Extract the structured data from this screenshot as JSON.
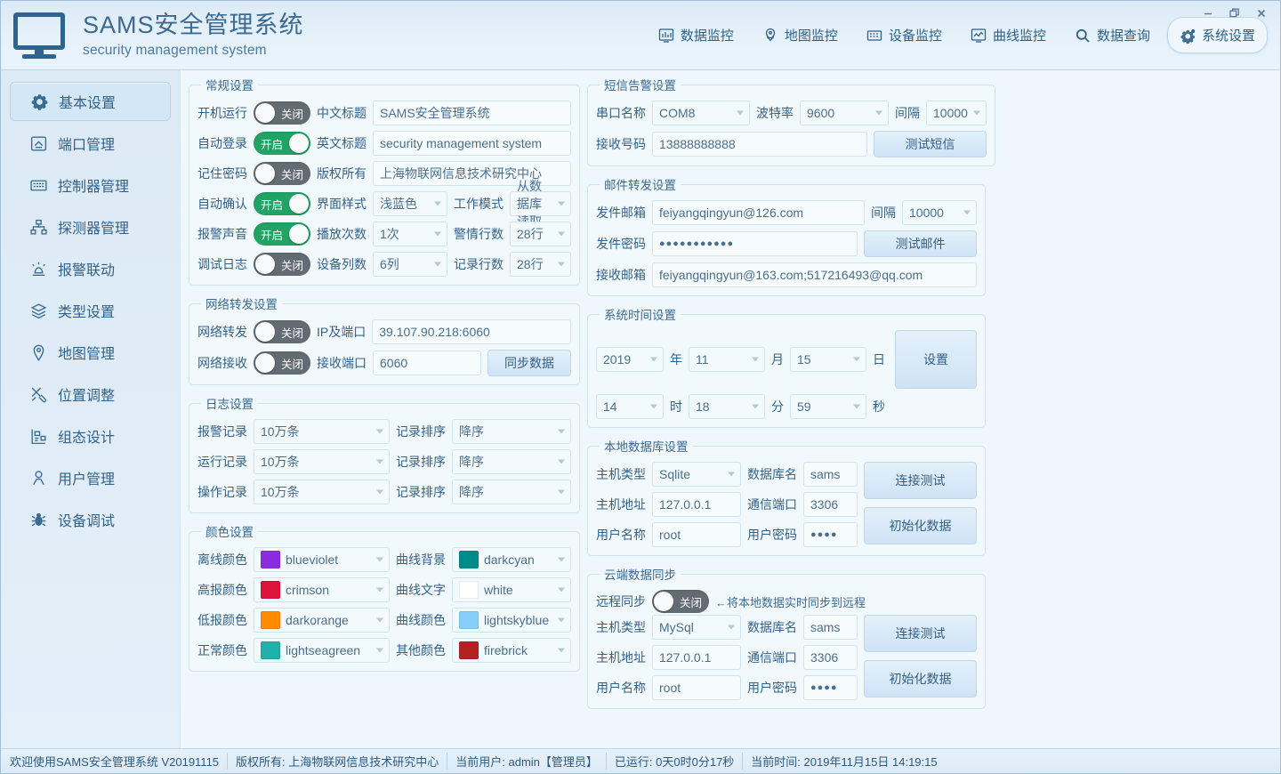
{
  "window": {
    "title_cn": "SAMS安全管理系统",
    "title_en": "security management system",
    "minimize": "─",
    "maximize": "❐",
    "close": "✕"
  },
  "nav": [
    {
      "label": "数据监控",
      "icon": "data-monitor-icon",
      "active": false
    },
    {
      "label": "地图监控",
      "icon": "map-monitor-icon",
      "active": false
    },
    {
      "label": "设备监控",
      "icon": "device-monitor-icon",
      "active": false
    },
    {
      "label": "曲线监控",
      "icon": "curve-monitor-icon",
      "active": false
    },
    {
      "label": "数据查询",
      "icon": "search-icon",
      "active": false
    },
    {
      "label": "系统设置",
      "icon": "gear-icon",
      "active": true
    }
  ],
  "sidebar": [
    {
      "label": "基本设置",
      "icon": "gear-icon",
      "active": true
    },
    {
      "label": "端口管理",
      "icon": "port-icon",
      "active": false
    },
    {
      "label": "控制器管理",
      "icon": "controller-icon",
      "active": false
    },
    {
      "label": "探测器管理",
      "icon": "detector-icon",
      "active": false
    },
    {
      "label": "报警联动",
      "icon": "alarm-icon",
      "active": false
    },
    {
      "label": "类型设置",
      "icon": "layers-icon",
      "active": false
    },
    {
      "label": "地图管理",
      "icon": "map-pin-icon",
      "active": false
    },
    {
      "label": "位置调整",
      "icon": "tools-icon",
      "active": false
    },
    {
      "label": "组态设计",
      "icon": "design-icon",
      "active": false
    },
    {
      "label": "用户管理",
      "icon": "user-icon",
      "active": false
    },
    {
      "label": "设备调试",
      "icon": "bug-icon",
      "active": false
    }
  ],
  "general": {
    "legend": "常规设置",
    "rows": [
      {
        "label": "开机运行",
        "switch": {
          "state": "off",
          "text": "关闭"
        },
        "label2": "中文标题",
        "value": "SAMS安全管理系统"
      },
      {
        "label": "自动登录",
        "switch": {
          "state": "on",
          "text": "开启"
        },
        "label2": "英文标题",
        "value": "security management system"
      },
      {
        "label": "记住密码",
        "switch": {
          "state": "off",
          "text": "关闭"
        },
        "label2": "版权所有",
        "value": "上海物联网信息技术研究中心"
      }
    ],
    "row4": {
      "label": "自动确认",
      "switch": {
        "state": "on",
        "text": "开启"
      },
      "label2": "界面样式",
      "value2": "浅蓝色",
      "label3": "工作模式",
      "value3": "从数据库读取"
    },
    "row5": {
      "label": "报警声音",
      "switch": {
        "state": "on",
        "text": "开启"
      },
      "label2": "播放次数",
      "value2": "1次",
      "label3": "警情行数",
      "value3": "28行"
    },
    "row6": {
      "label": "调试日志",
      "switch": {
        "state": "off",
        "text": "关闭"
      },
      "label2": "设备列数",
      "value2": "6列",
      "label3": "记录行数",
      "value3": "28行"
    }
  },
  "network": {
    "legend": "网络转发设置",
    "forward_label": "网络转发",
    "forward_switch": {
      "state": "off",
      "text": "关闭"
    },
    "ip_label": "IP及端口",
    "ip_value": "39.107.90.218:6060",
    "receive_label": "网络接收",
    "receive_switch": {
      "state": "off",
      "text": "关闭"
    },
    "port_label": "接收端口",
    "port_value": "6060",
    "sync_button": "同步数据"
  },
  "log": {
    "legend": "日志设置",
    "rows": [
      {
        "label": "报警记录",
        "value": "10万条",
        "label2": "记录排序",
        "value2": "降序"
      },
      {
        "label": "运行记录",
        "value": "10万条",
        "label2": "记录排序",
        "value2": "降序"
      },
      {
        "label": "操作记录",
        "value": "10万条",
        "label2": "记录排序",
        "value2": "降序"
      }
    ]
  },
  "colors": {
    "legend": "颜色设置",
    "rows": [
      {
        "label": "离线颜色",
        "value": "blueviolet",
        "hex": "#8a2be2",
        "label2": "曲线背景",
        "value2": "darkcyan",
        "hex2": "#008b8b"
      },
      {
        "label": "高报颜色",
        "value": "crimson",
        "hex": "#dc143c",
        "label2": "曲线文字",
        "value2": "white",
        "hex2": "#ffffff"
      },
      {
        "label": "低报颜色",
        "value": "darkorange",
        "hex": "#ff8c00",
        "label2": "曲线颜色",
        "value2": "lightskyblue",
        "hex2": "#87cefa"
      },
      {
        "label": "正常颜色",
        "value": "lightseagreen",
        "hex": "#20b2aa",
        "label2": "其他颜色",
        "value2": "firebrick",
        "hex2": "#b22222"
      }
    ]
  },
  "sms": {
    "legend": "短信告警设置",
    "port_label": "串口名称",
    "port_value": "COM8",
    "baud_label": "波特率",
    "baud_value": "9600",
    "interval_label": "间隔",
    "interval_value": "10000",
    "number_label": "接收号码",
    "number_value": "13888888888",
    "test_button": "测试短信"
  },
  "email": {
    "legend": "邮件转发设置",
    "sender_label": "发件邮箱",
    "sender_value": "feiyangqingyun@126.com",
    "interval_label": "间隔",
    "interval_value": "10000",
    "password_label": "发件密码",
    "password_value": "●●●●●●●●●●●",
    "test_button": "测试邮件",
    "receiver_label": "接收邮箱",
    "receiver_value": "feiyangqingyun@163.com;517216493@qq.com"
  },
  "systime": {
    "legend": "系统时间设置",
    "year": "2019",
    "year_unit": "年",
    "month": "11",
    "month_unit": "月",
    "day": "15",
    "day_unit": "日",
    "hour": "14",
    "hour_unit": "时",
    "minute": "18",
    "minute_unit": "分",
    "second": "59",
    "second_unit": "秒",
    "set_button": "设置"
  },
  "localdb": {
    "legend": "本地数据库设置",
    "host_type_label": "主机类型",
    "host_type_value": "Sqlite",
    "db_name_label": "数据库名",
    "db_name_value": "sams",
    "host_addr_label": "主机地址",
    "host_addr_value": "127.0.0.1",
    "db_port_label": "通信端口",
    "db_port_value": "3306",
    "user_label": "用户名称",
    "user_value": "root",
    "pass_label": "用户密码",
    "pass_value": "●●●●",
    "test_button": "连接测试",
    "init_button": "初始化数据"
  },
  "clouddb": {
    "legend": "云端数据同步",
    "sync_label": "远程同步",
    "sync_switch": {
      "state": "off",
      "text": "关闭"
    },
    "hint": "←将本地数据实时同步到远程",
    "host_type_label": "主机类型",
    "host_type_value": "MySql",
    "db_name_label": "数据库名",
    "db_name_value": "sams",
    "host_addr_label": "主机地址",
    "host_addr_value": "127.0.0.1",
    "db_port_label": "通信端口",
    "db_port_value": "3306",
    "user_label": "用户名称",
    "user_value": "root",
    "pass_label": "用户密码",
    "pass_value": "●●●●",
    "test_button": "连接测试",
    "init_button": "初始化数据"
  },
  "statusbar": [
    "欢迎使用SAMS安全管理系统 V20191115",
    "版权所有: 上海物联网信息技术研究中心",
    "当前用户: admin【管理员】",
    "已运行: 0天0时0分17秒",
    "当前时间: 2019年11月15日 14:19:15"
  ],
  "theme": {
    "accent": "#3c6a92",
    "switch_on": "#21a366",
    "switch_off": "#636b73",
    "panel_bg": "#f1f9fd",
    "content_bg": "#eef7fc"
  }
}
